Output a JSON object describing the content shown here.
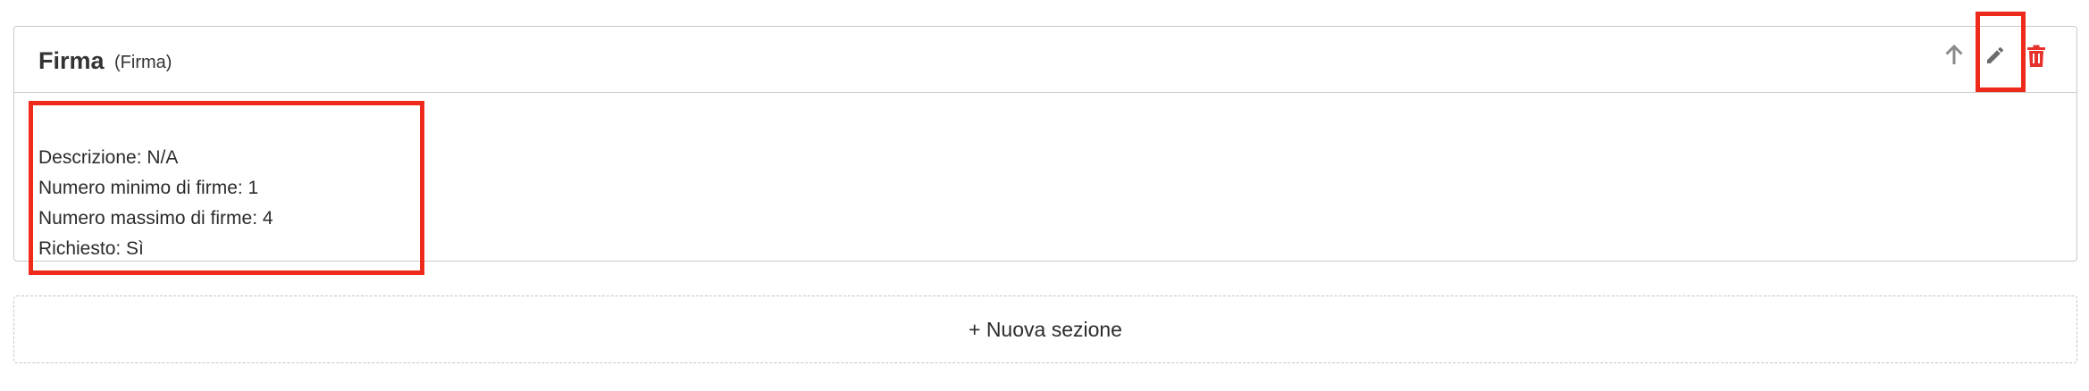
{
  "section": {
    "title": "Firma",
    "subtitle": "(Firma)",
    "details": [
      "Descrizione: N/A",
      "Numero minimo di firme: 1",
      "Numero massimo di firme: 4",
      "Richiesto: Sì"
    ],
    "actions": {
      "move_up_icon": "arrow-up-icon",
      "edit_icon": "pencil-icon",
      "delete_icon": "trash-icon"
    }
  },
  "new_section_label": "+ Nuova sezione",
  "colors": {
    "border": "#c9c9c9",
    "icon_gray": "#8a8a8a",
    "edit_icon": "#6b6b6b",
    "delete_red": "#e5322d",
    "highlight_red": "#ee2a1a",
    "text": "#2b2b2b"
  }
}
